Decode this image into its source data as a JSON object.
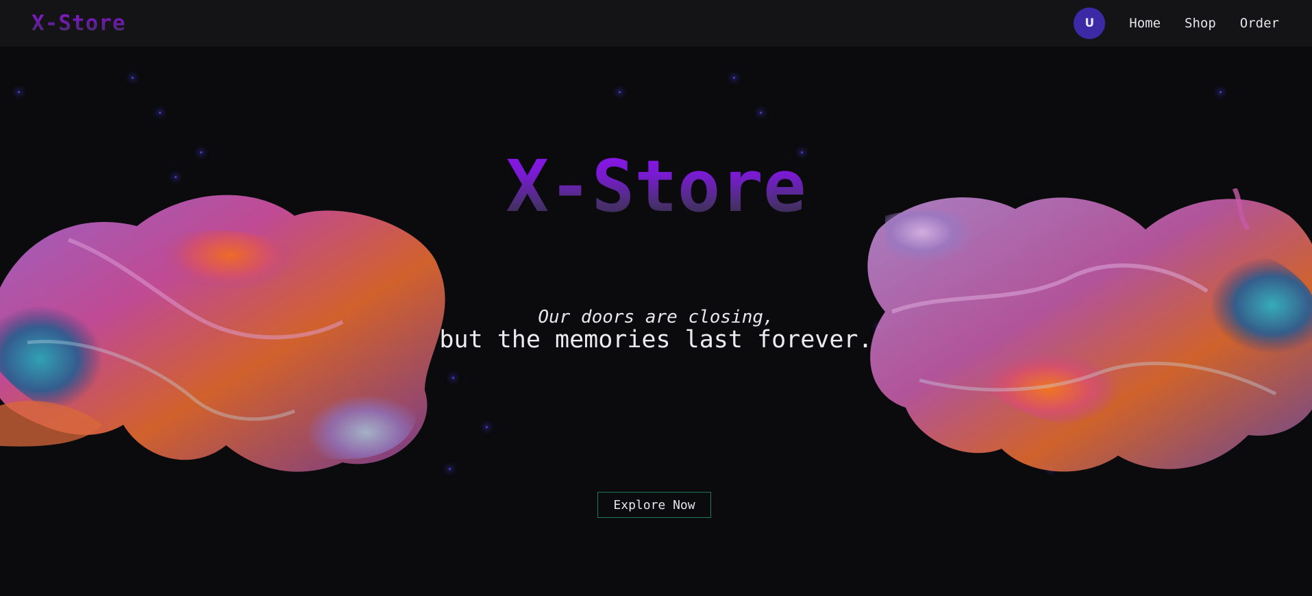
{
  "navbar": {
    "brand": "X-Store",
    "avatar_initial": "U",
    "links": [
      "Home",
      "Shop",
      "Order"
    ]
  },
  "hero": {
    "title": "X-Store",
    "tagline_line1": "Our doors are closing,",
    "tagline_line2": "but the memories last forever.",
    "cta_label": "Explore Now"
  },
  "colors": {
    "background": "#0b0b0e",
    "navbar": "#141416",
    "accent_purple": "#8f14f0",
    "avatar": "#3b29a6",
    "button_border": "#1f7a5a"
  }
}
